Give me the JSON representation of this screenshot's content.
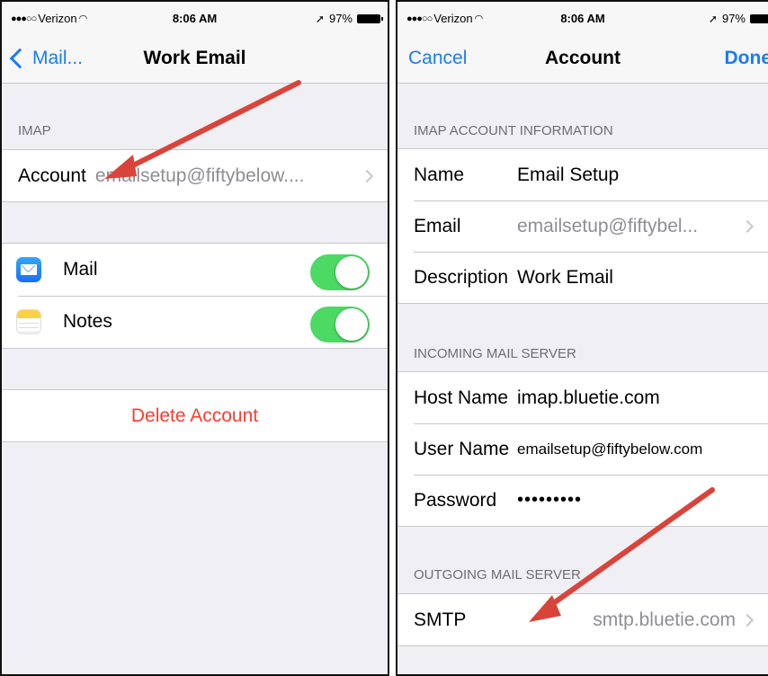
{
  "left_screen": {
    "status": {
      "carrier": "Verizon",
      "time": "8:06 AM",
      "battery": "97%"
    },
    "nav": {
      "back_label": "Mail...",
      "title": "Work Email"
    },
    "imap_header": "IMAP",
    "account_row": {
      "label": "Account",
      "value": "emailsetup@fiftybelow...."
    },
    "apps": [
      {
        "label": "Mail",
        "icon": "mail-icon",
        "enabled": true
      },
      {
        "label": "Notes",
        "icon": "notes-icon",
        "enabled": true
      }
    ],
    "delete_label": "Delete Account"
  },
  "right_screen": {
    "status": {
      "carrier": "Verizon",
      "time": "8:06 AM",
      "battery": "97%"
    },
    "nav": {
      "cancel_label": "Cancel",
      "title": "Account",
      "done_label": "Done"
    },
    "account_info": {
      "header": "IMAP ACCOUNT INFORMATION",
      "name": {
        "label": "Name",
        "value": "Email Setup"
      },
      "email": {
        "label": "Email",
        "value": "emailsetup@fiftybel..."
      },
      "description": {
        "label": "Description",
        "value": "Work Email"
      }
    },
    "incoming": {
      "header": "INCOMING MAIL SERVER",
      "host": {
        "label": "Host Name",
        "value": "imap.bluetie.com"
      },
      "user": {
        "label": "User Name",
        "value": "emailsetup@fiftybelow.com"
      },
      "password": {
        "label": "Password",
        "value": "•••••••••"
      }
    },
    "outgoing": {
      "header": "OUTGOING MAIL SERVER",
      "smtp": {
        "label": "SMTP",
        "value": "smtp.bluetie.com"
      }
    }
  },
  "colors": {
    "ios_blue": "#1a7cf5",
    "toggle_green": "#4cd964",
    "delete_red": "#ff3b30",
    "annotation_arrow": "#d9443a"
  }
}
